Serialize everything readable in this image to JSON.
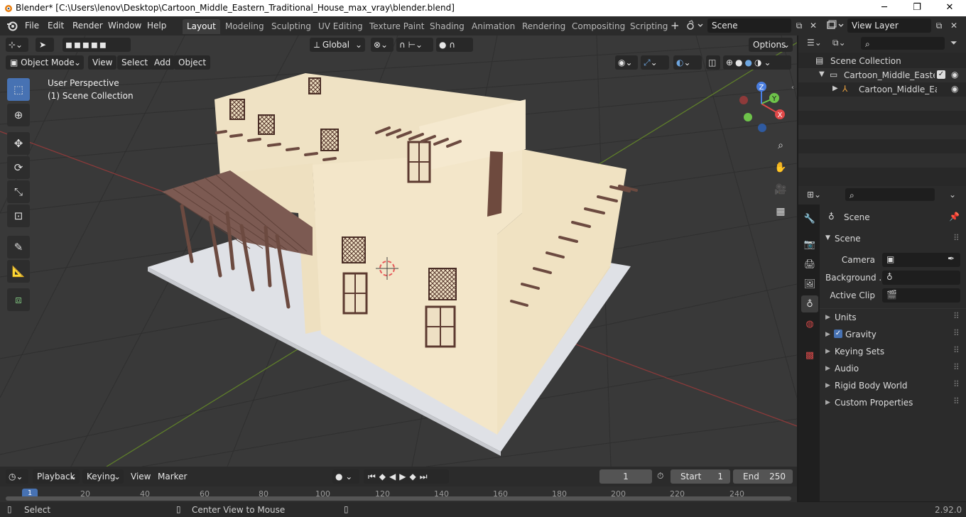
{
  "titlebar": {
    "title": "Blender* [C:\\Users\\lenov\\Desktop\\Cartoon_Middle_Eastern_Traditional_House_max_vray\\blender.blend]",
    "minimize": "─",
    "maximize": "❐",
    "close": "✕"
  },
  "menu": [
    "File",
    "Edit",
    "Render",
    "Window",
    "Help"
  ],
  "workspaces": [
    "Layout",
    "Modeling",
    "Sculpting",
    "UV Editing",
    "Texture Paint",
    "Shading",
    "Animation",
    "Rendering",
    "Compositing",
    "Scripting"
  ],
  "scene_name": "Scene",
  "view_layer": "View Layer",
  "toolbar_header": {
    "transform_orientation": "Global",
    "options": "Options"
  },
  "viewport_header": {
    "mode": "Object Mode",
    "menus": [
      "View",
      "Select",
      "Add",
      "Object"
    ]
  },
  "viewport": {
    "perspective": "User Perspective",
    "collection": "(1) Scene Collection",
    "gizmo": {
      "x": "X",
      "y": "Y",
      "z": "Z"
    }
  },
  "outliner": {
    "root": "Scene Collection",
    "items": [
      {
        "label": "Cartoon_Middle_Eastern_"
      },
      {
        "label": "Cartoon_Middle_East"
      }
    ]
  },
  "properties": {
    "header": "Scene",
    "panel_title": "Scene",
    "fields": [
      {
        "label": "Camera"
      },
      {
        "label": "Background ..."
      },
      {
        "label": "Active Clip"
      }
    ],
    "panels": [
      "Units",
      "Gravity",
      "Keying Sets",
      "Audio",
      "Rigid Body World",
      "Custom Properties"
    ]
  },
  "timeline": {
    "menus": [
      "Playback",
      "Keying",
      "View",
      "Marker"
    ],
    "current_frame": "1",
    "start_label": "Start",
    "start_value": "1",
    "end_label": "End",
    "end_value": "250",
    "ticks": [
      "1",
      "20",
      "40",
      "60",
      "80",
      "100",
      "120",
      "140",
      "160",
      "180",
      "200",
      "220",
      "240"
    ]
  },
  "status": {
    "left": "Select",
    "middle": "Center View to Mouse",
    "version": "2.92.0"
  }
}
